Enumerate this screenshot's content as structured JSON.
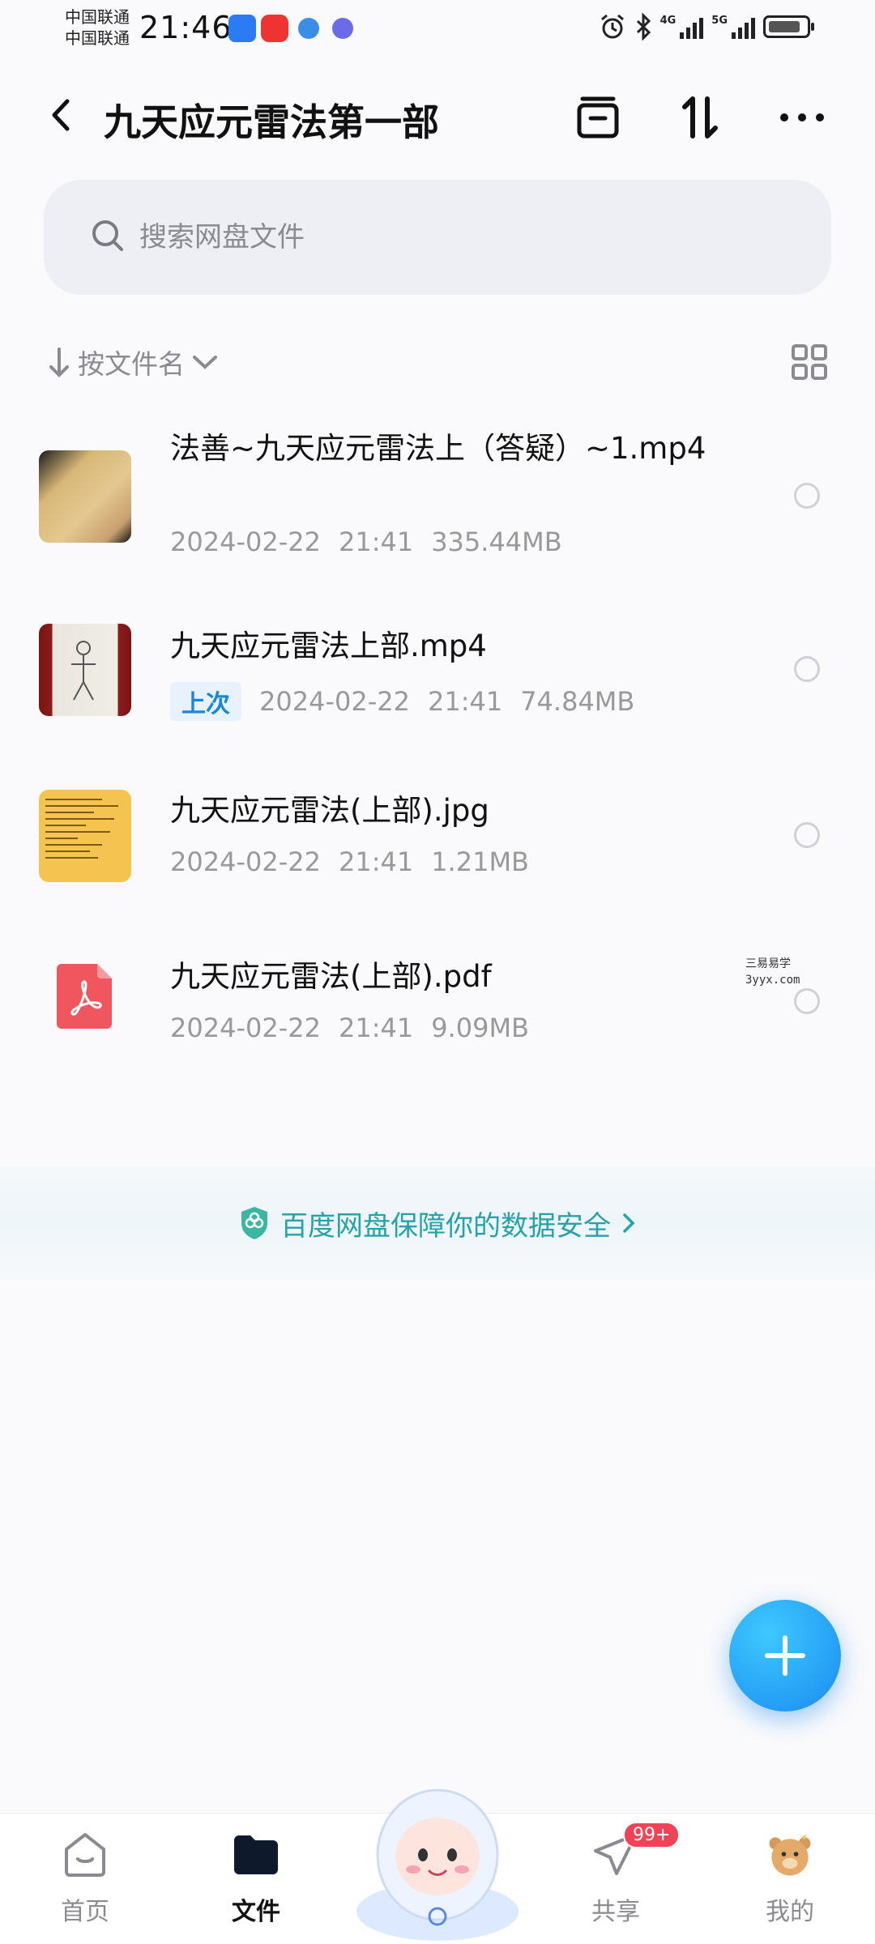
{
  "status_bar": {
    "carrier_1": "中国联通",
    "carrier_2": "中国联通",
    "time": "21:46",
    "net_1": "4G",
    "net_2": "5G"
  },
  "header": {
    "title": "九天应元雷法第一部"
  },
  "search": {
    "placeholder": "搜索网盘文件"
  },
  "sort": {
    "label": "按文件名"
  },
  "files": [
    {
      "name": "法善~九天应元雷法上（答疑）~1.mp4",
      "date": "2024-02-22",
      "time": "21:41",
      "size": "335.44MB",
      "type": "video"
    },
    {
      "name": "九天应元雷法上部.mp4",
      "badge": "上次",
      "date": "2024-02-22",
      "time": "21:41",
      "size": "74.84MB",
      "type": "video"
    },
    {
      "name": "九天应元雷法(上部).jpg",
      "date": "2024-02-22",
      "time": "21:41",
      "size": "1.21MB",
      "type": "image"
    },
    {
      "name": "九天应元雷法(上部).pdf",
      "date": "2024-02-22",
      "time": "21:41",
      "size": "9.09MB",
      "type": "pdf"
    }
  ],
  "watermark": {
    "line1": "三易易学",
    "line2": "3yyx.com"
  },
  "security": {
    "text": "百度网盘保障你的数据安全"
  },
  "bottom_nav": {
    "home": "首页",
    "files": "文件",
    "share": "共享",
    "share_badge": "99+",
    "me": "我的"
  },
  "colors": {
    "accent": "#1a8cf0",
    "teal": "#25a3a8",
    "badge_red": "#f24257",
    "pdf_red": "#f0565e"
  }
}
